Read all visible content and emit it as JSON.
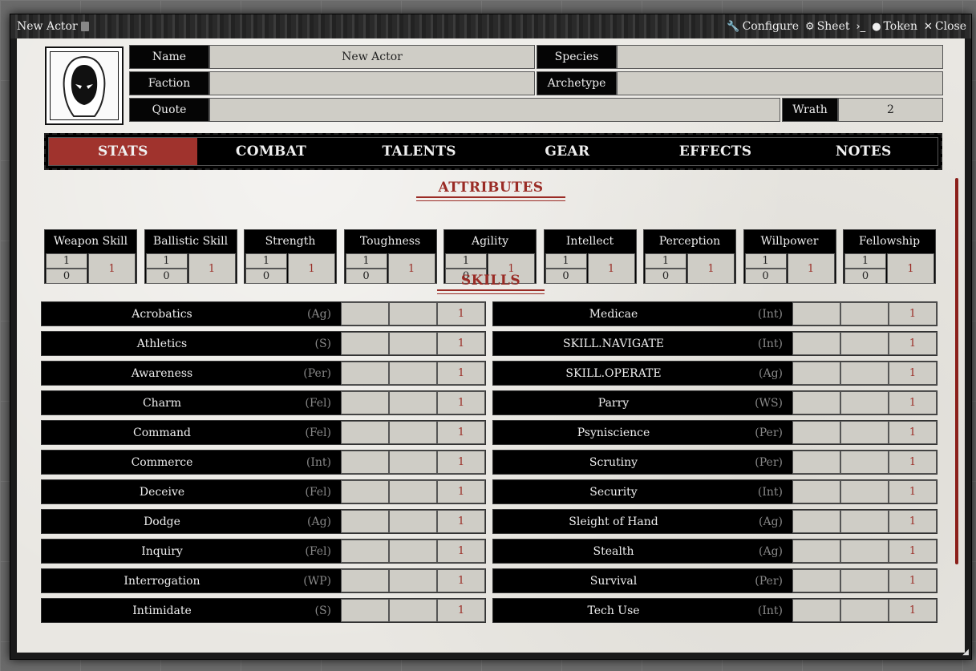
{
  "window": {
    "title": "New Actor",
    "controls": [
      {
        "label": "Configure",
        "icon": "wrench-icon",
        "glyph": "🔧"
      },
      {
        "label": "Sheet",
        "icon": "gear-icon",
        "glyph": "⚙"
      },
      {
        "label": "",
        "icon": "terminal-icon",
        "glyph": "›_"
      },
      {
        "label": "Token",
        "icon": "user-circle-icon",
        "glyph": "●"
      },
      {
        "label": "Close",
        "icon": "close-icon",
        "glyph": "✕"
      }
    ]
  },
  "header": {
    "name_label": "Name",
    "name_value": "New Actor",
    "species_label": "Species",
    "species_value": "",
    "faction_label": "Faction",
    "faction_value": "",
    "archetype_label": "Archetype",
    "archetype_value": "",
    "quote_label": "Quote",
    "quote_value": "",
    "wrath_label": "Wrath",
    "wrath_value": "2"
  },
  "tabs": [
    "STATS",
    "COMBAT",
    "TALENTS",
    "GEAR",
    "EFFECTS",
    "NOTES"
  ],
  "active_tab": "STATS",
  "attributes_title": "ATTRIBUTES",
  "attributes": [
    {
      "name": "Weapon Skill",
      "top": "1",
      "bottom": "0",
      "total": "1"
    },
    {
      "name": "Ballistic Skill",
      "top": "1",
      "bottom": "0",
      "total": "1"
    },
    {
      "name": "Strength",
      "top": "1",
      "bottom": "0",
      "total": "1"
    },
    {
      "name": "Toughness",
      "top": "1",
      "bottom": "0",
      "total": "1"
    },
    {
      "name": "Agility",
      "top": "1",
      "bottom": "0",
      "total": "1"
    },
    {
      "name": "Intellect",
      "top": "1",
      "bottom": "0",
      "total": "1"
    },
    {
      "name": "Perception",
      "top": "1",
      "bottom": "0",
      "total": "1"
    },
    {
      "name": "Willpower",
      "top": "1",
      "bottom": "0",
      "total": "1"
    },
    {
      "name": "Fellowship",
      "top": "1",
      "bottom": "0",
      "total": "1"
    }
  ],
  "skills_title": "SKILLS",
  "skills_left": [
    {
      "name": "Acrobatics",
      "attr": "(Ag)",
      "total": "1"
    },
    {
      "name": "Athletics",
      "attr": "(S)",
      "total": "1"
    },
    {
      "name": "Awareness",
      "attr": "(Per)",
      "total": "1"
    },
    {
      "name": "Charm",
      "attr": "(Fel)",
      "total": "1"
    },
    {
      "name": "Command",
      "attr": "(Fel)",
      "total": "1"
    },
    {
      "name": "Commerce",
      "attr": "(Int)",
      "total": "1"
    },
    {
      "name": "Deceive",
      "attr": "(Fel)",
      "total": "1"
    },
    {
      "name": "Dodge",
      "attr": "(Ag)",
      "total": "1"
    },
    {
      "name": "Inquiry",
      "attr": "(Fel)",
      "total": "1"
    },
    {
      "name": "Interrogation",
      "attr": "(WP)",
      "total": "1"
    },
    {
      "name": "Intimidate",
      "attr": "(S)",
      "total": "1"
    }
  ],
  "skills_right": [
    {
      "name": "Medicae",
      "attr": "(Int)",
      "total": "1"
    },
    {
      "name": "SKILL.NAVIGATE",
      "attr": "(Int)",
      "total": "1"
    },
    {
      "name": "SKILL.OPERATE",
      "attr": "(Ag)",
      "total": "1"
    },
    {
      "name": "Parry",
      "attr": "(WS)",
      "total": "1"
    },
    {
      "name": "Psyniscience",
      "attr": "(Per)",
      "total": "1"
    },
    {
      "name": "Scrutiny",
      "attr": "(Per)",
      "total": "1"
    },
    {
      "name": "Security",
      "attr": "(Int)",
      "total": "1"
    },
    {
      "name": "Sleight of Hand",
      "attr": "(Ag)",
      "total": "1"
    },
    {
      "name": "Stealth",
      "attr": "(Ag)",
      "total": "1"
    },
    {
      "name": "Survival",
      "attr": "(Per)",
      "total": "1"
    },
    {
      "name": "Tech Use",
      "attr": "(Int)",
      "total": "1"
    }
  ],
  "colors": {
    "accent": "#a0332d",
    "label_bg": "#050505",
    "field_bg": "#cfcdc6",
    "parchment": "#e9e7e2"
  }
}
